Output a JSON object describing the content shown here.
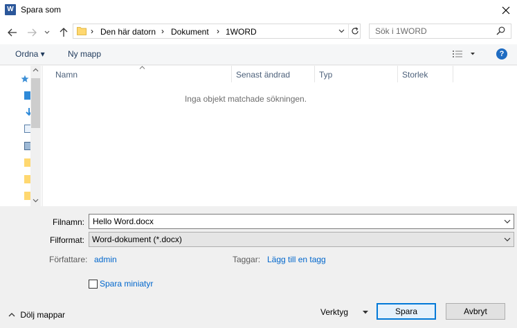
{
  "window": {
    "title": "Spara som",
    "app_icon_letter": "W"
  },
  "address": {
    "crumbs": [
      "Den här datorn",
      "Dokument",
      "1WORD"
    ],
    "separator": "›"
  },
  "search": {
    "placeholder": "Sök i 1WORD"
  },
  "toolbar": {
    "organize": "Ordna ▾",
    "new_folder": "Ny mapp",
    "help": "?"
  },
  "columns": [
    "Namn",
    "Senast ändrad",
    "Typ",
    "Storlek"
  ],
  "list": {
    "empty_message": "Inga objekt matchade sökningen."
  },
  "form": {
    "filename_label": "Filnamn:",
    "filename_value": "Hello Word.docx",
    "format_label": "Filformat:",
    "format_value": "Word-dokument (*.docx)",
    "author_label": "Författare:",
    "author_value": "admin",
    "tags_label": "Taggar:",
    "tags_value": "Lägg till en tagg",
    "thumbnail_label": "Spara miniatyr"
  },
  "footer": {
    "hide_folders": "Dölj mappar",
    "tools": "Verktyg",
    "save": "Spara",
    "cancel": "Avbryt"
  },
  "colors": {
    "accent": "#0078d7",
    "link": "#0066cc",
    "word_blue": "#2b579a"
  }
}
